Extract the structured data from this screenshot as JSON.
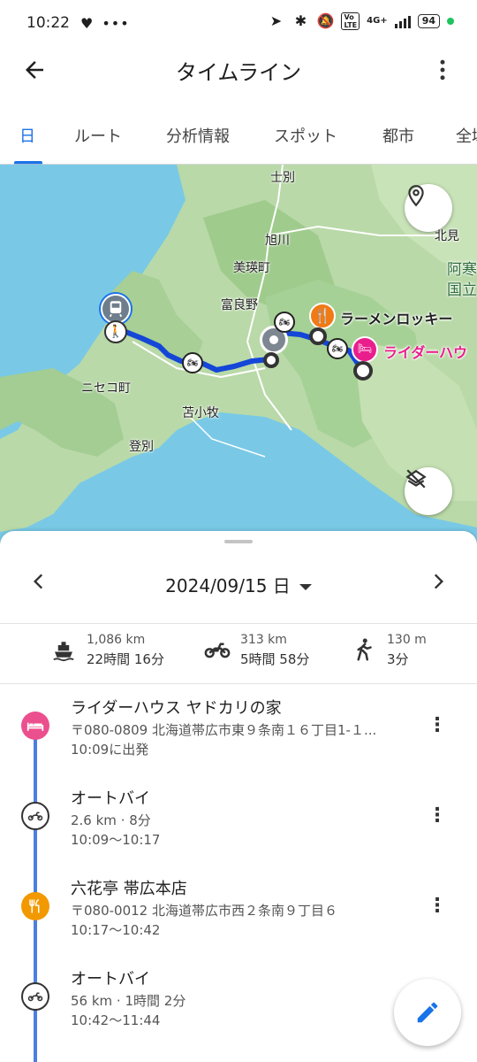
{
  "status": {
    "time": "10:22",
    "battery": "94",
    "network": "4G+"
  },
  "appbar": {
    "title": "タイムライン"
  },
  "tabs": [
    "日",
    "ルート",
    "分析情報",
    "スポット",
    "都市",
    "全域"
  ],
  "map": {
    "labels": {
      "shibetsu": "士別",
      "asahikawa": "旭川",
      "kitami": "北見",
      "biei": "美瑛町",
      "akan": "阿寒",
      "kokuritsu": "国立",
      "furano": "富良野",
      "niseko": "ニセコ町",
      "tomakomai": "苫小牧",
      "noboribetsu": "登別"
    },
    "poi": {
      "ramen": "ラーメンロッキー",
      "rider": "ライダーハウ"
    },
    "colors": {
      "route": "#1446d8",
      "ramen": "#f07a16",
      "rider": "#e91e8c"
    }
  },
  "sheet": {
    "date": "2024/09/15 日",
    "stats": [
      {
        "icon": "ferry-icon",
        "distance": "1,086 km",
        "duration": "22時間 16分"
      },
      {
        "icon": "motorcycle-icon",
        "distance": "313 km",
        "duration": "5時間 58分"
      },
      {
        "icon": "walking-icon",
        "distance": "130 m",
        "duration": "3分"
      }
    ],
    "items": [
      {
        "type": "place",
        "title": "ライダーハウス ヤドカリの家",
        "line2": "〒080-0809 北海道帯広市東９条南１６丁目1-１...",
        "line3": "10:09に出発"
      },
      {
        "type": "moto",
        "title": "オートバイ",
        "line2": "2.6 km · 8分",
        "line3": "10:09〜10:17"
      },
      {
        "type": "food",
        "title": "六花亭 帯広本店",
        "line2": "〒080-0012 北海道帯広市西２条南９丁目６",
        "line3": "10:17〜10:42"
      },
      {
        "type": "moto",
        "title": "オートバイ",
        "line2": "56 km · 1時間 2分",
        "line3": "10:42〜11:44"
      }
    ]
  }
}
